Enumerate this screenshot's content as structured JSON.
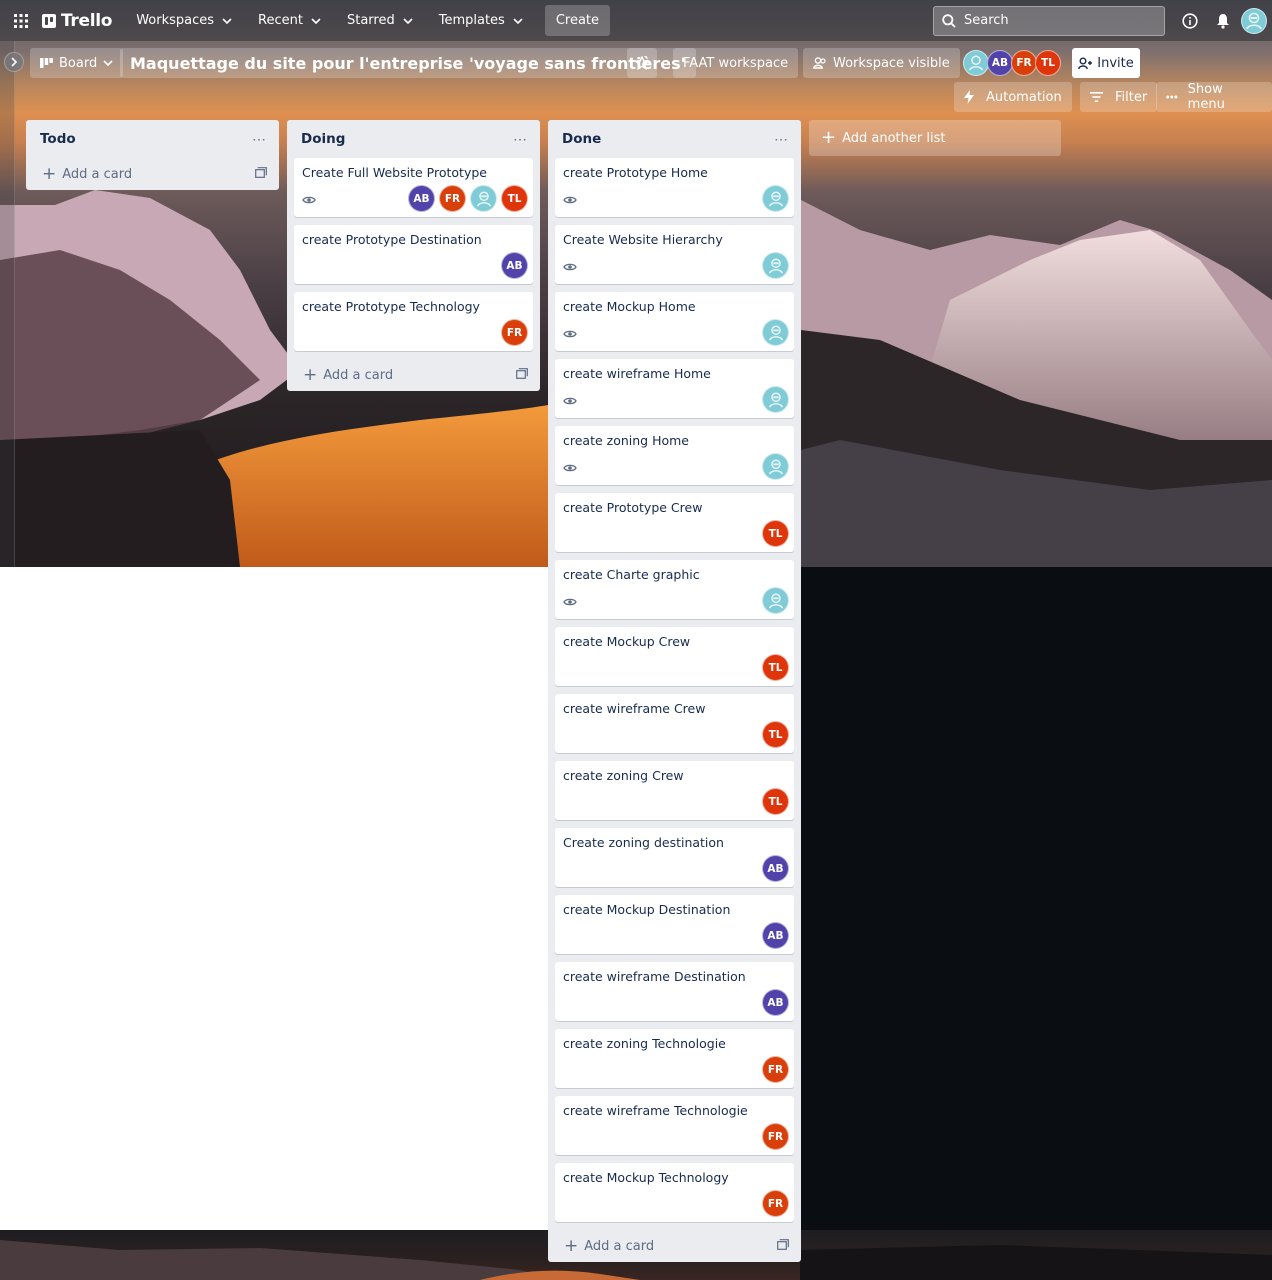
{
  "nav": {
    "logo": "Trello",
    "items": [
      {
        "label": "Workspaces"
      },
      {
        "label": "Recent"
      },
      {
        "label": "Starred"
      },
      {
        "label": "Templates"
      }
    ],
    "create_label": "Create",
    "search_placeholder": "Search"
  },
  "board": {
    "view_label": "Board",
    "title": "Maquettage du site pour l'entreprise 'voyage sans frontières'",
    "workspace_label": "FAAT workspace",
    "visibility_label": "Workspace visible",
    "invite_label": "Invite",
    "automation_label": "Automation",
    "filter_label": "Filter",
    "show_menu_label": "Show menu",
    "members": [
      "me",
      "AB",
      "FR",
      "TL"
    ]
  },
  "lists": [
    {
      "title": "Todo",
      "add_card": "Add a card",
      "cards": []
    },
    {
      "title": "Doing",
      "add_card": "Add a card",
      "cards": [
        {
          "title": "Create Full Website Prototype",
          "watch": true,
          "members": [
            "AB",
            "FR",
            "me",
            "TL"
          ]
        },
        {
          "title": "create Prototype Destination",
          "watch": false,
          "members": [
            "AB"
          ]
        },
        {
          "title": "create Prototype Technology",
          "watch": false,
          "members": [
            "FR"
          ]
        }
      ]
    },
    {
      "title": "Done",
      "add_card": "Add a card",
      "cards": [
        {
          "title": "create Prototype Home",
          "watch": true,
          "members": [
            "me"
          ]
        },
        {
          "title": "Create Website Hierarchy",
          "watch": true,
          "members": [
            "me"
          ]
        },
        {
          "title": "create Mockup Home",
          "watch": true,
          "members": [
            "me"
          ]
        },
        {
          "title": "create wireframe Home",
          "watch": true,
          "members": [
            "me"
          ]
        },
        {
          "title": "create zoning Home",
          "watch": true,
          "members": [
            "me"
          ]
        },
        {
          "title": "create Prototype Crew",
          "watch": false,
          "members": [
            "TL"
          ]
        },
        {
          "title": "create Charte graphic",
          "watch": true,
          "members": [
            "me"
          ]
        },
        {
          "title": "create Mockup Crew",
          "watch": false,
          "members": [
            "TL"
          ]
        },
        {
          "title": "create wireframe Crew",
          "watch": false,
          "members": [
            "TL"
          ]
        },
        {
          "title": "create zoning Crew",
          "watch": false,
          "members": [
            "TL"
          ]
        },
        {
          "title": "Create zoning destination",
          "watch": false,
          "members": [
            "AB"
          ]
        },
        {
          "title": "create Mockup Destination",
          "watch": false,
          "members": [
            "AB"
          ]
        },
        {
          "title": "create wireframe Destination",
          "watch": false,
          "members": [
            "AB"
          ]
        },
        {
          "title": "create zoning Technologie",
          "watch": false,
          "members": [
            "FR"
          ]
        },
        {
          "title": "create wireframe Technologie",
          "watch": false,
          "members": [
            "FR"
          ]
        },
        {
          "title": "create Mockup Technology",
          "watch": false,
          "members": [
            "FR"
          ]
        }
      ]
    }
  ],
  "add_list_label": "Add another list",
  "colors": {
    "AB": "#5243aa",
    "FR": "#d93f0b",
    "TL": "#de350b",
    "me": "#7fcbd6",
    "list_bg": "#ebecf0"
  },
  "icons": [
    "apps-grid-icon",
    "chevron-down-icon",
    "search-icon",
    "info-icon",
    "bell-icon",
    "star-icon",
    "board-icon",
    "people-icon",
    "lightning-icon",
    "filter-icon",
    "more-icon",
    "eye-icon",
    "template-icon",
    "plus-icon",
    "add-person-icon"
  ]
}
